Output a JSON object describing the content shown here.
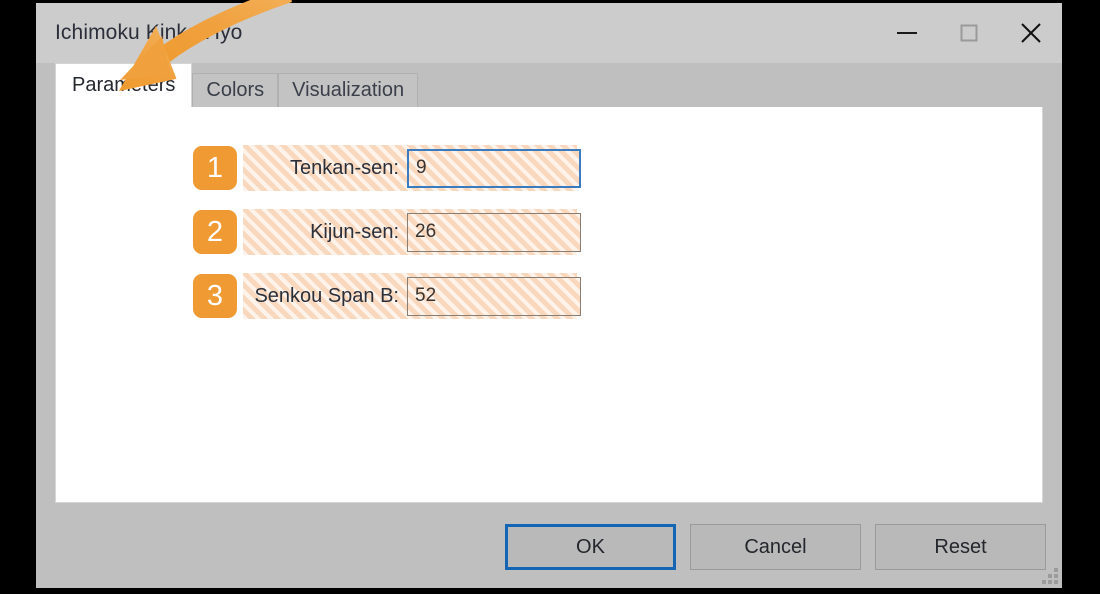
{
  "window": {
    "title": "Ichimoku Kinko Hyo",
    "controls": {
      "minimize": "minimize-icon",
      "maximize": "maximize-icon",
      "close": "close-icon"
    }
  },
  "tabs": [
    {
      "label": "Parameters",
      "active": true
    },
    {
      "label": "Colors",
      "active": false
    },
    {
      "label": "Visualization",
      "active": false
    }
  ],
  "parameters": [
    {
      "badge": "1",
      "label": "Tenkan-sen:",
      "value": "9",
      "focused": true
    },
    {
      "badge": "2",
      "label": "Kijun-sen:",
      "value": "26",
      "focused": false
    },
    {
      "badge": "3",
      "label": "Senkou Span B:",
      "value": "52",
      "focused": false
    }
  ],
  "buttons": [
    {
      "label": "OK",
      "default": true
    },
    {
      "label": "Cancel",
      "default": false
    },
    {
      "label": "Reset",
      "default": false
    }
  ],
  "annotation": {
    "arrow": "curved-arrow-pointing-to-parameters-tab",
    "color": "#f0a03c"
  },
  "colors": {
    "accent_orange": "#ef9a33",
    "focus_blue": "#3b7cc0",
    "default_button_blue": "#1565b5",
    "highlight_peach": "#fbe4d2",
    "dialog_gray": "#bfbfbf",
    "titlebar_gray": "#cccccc"
  }
}
